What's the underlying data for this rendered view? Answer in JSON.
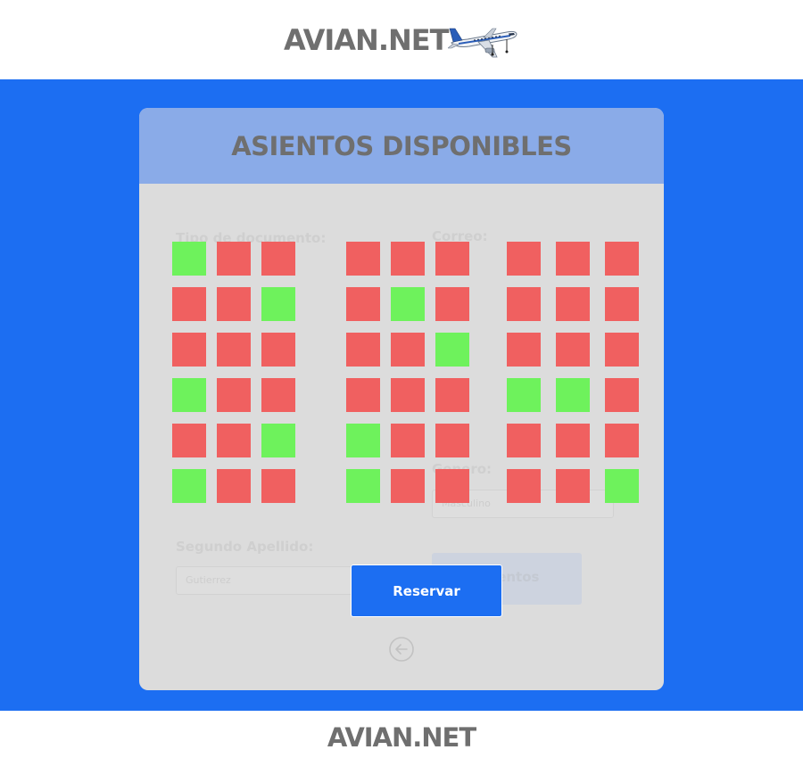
{
  "header": {
    "brand": "AVIAN.NET",
    "logo_icon": "airplane-icon"
  },
  "card": {
    "title": "ASIENTOS DISPONIBLES"
  },
  "background_form": {
    "tipo_documento_label": "Tipo de documento:",
    "correo_label": "Correo:",
    "segundo_apellido_label": "Segundo Apellido:",
    "segundo_apellido_value": "Gutierrez",
    "genero_label": "Genero:",
    "genero_value": "Masculino",
    "ghost_button_label": "Asientos"
  },
  "seats": {
    "legend_colors": {
      "occupied": "#f06060",
      "available": "#6ef25c"
    },
    "rows": [
      [
        "available",
        "occupied",
        "occupied",
        "occupied",
        "occupied",
        "occupied",
        "occupied",
        "occupied",
        "occupied"
      ],
      [
        "occupied",
        "occupied",
        "available",
        "occupied",
        "available",
        "occupied",
        "occupied",
        "occupied",
        "occupied"
      ],
      [
        "occupied",
        "occupied",
        "occupied",
        "occupied",
        "occupied",
        "available",
        "occupied",
        "occupied",
        "occupied"
      ],
      [
        "available",
        "occupied",
        "occupied",
        "occupied",
        "occupied",
        "occupied",
        "available",
        "available",
        "occupied"
      ],
      [
        "occupied",
        "occupied",
        "available",
        "available",
        "occupied",
        "occupied",
        "occupied",
        "occupied",
        "occupied"
      ],
      [
        "available",
        "occupied",
        "occupied",
        "available",
        "occupied",
        "occupied",
        "occupied",
        "occupied",
        "available"
      ]
    ]
  },
  "actions": {
    "reserve_label": "Reservar",
    "back_icon": "back-arrow-icon"
  },
  "footer": {
    "brand": "AVIAN.NET"
  },
  "colors": {
    "primary": "#1c6ef2",
    "card_header": "#8aabe8",
    "card_body": "#dcdcdc",
    "title_text": "#6f6f6f"
  }
}
